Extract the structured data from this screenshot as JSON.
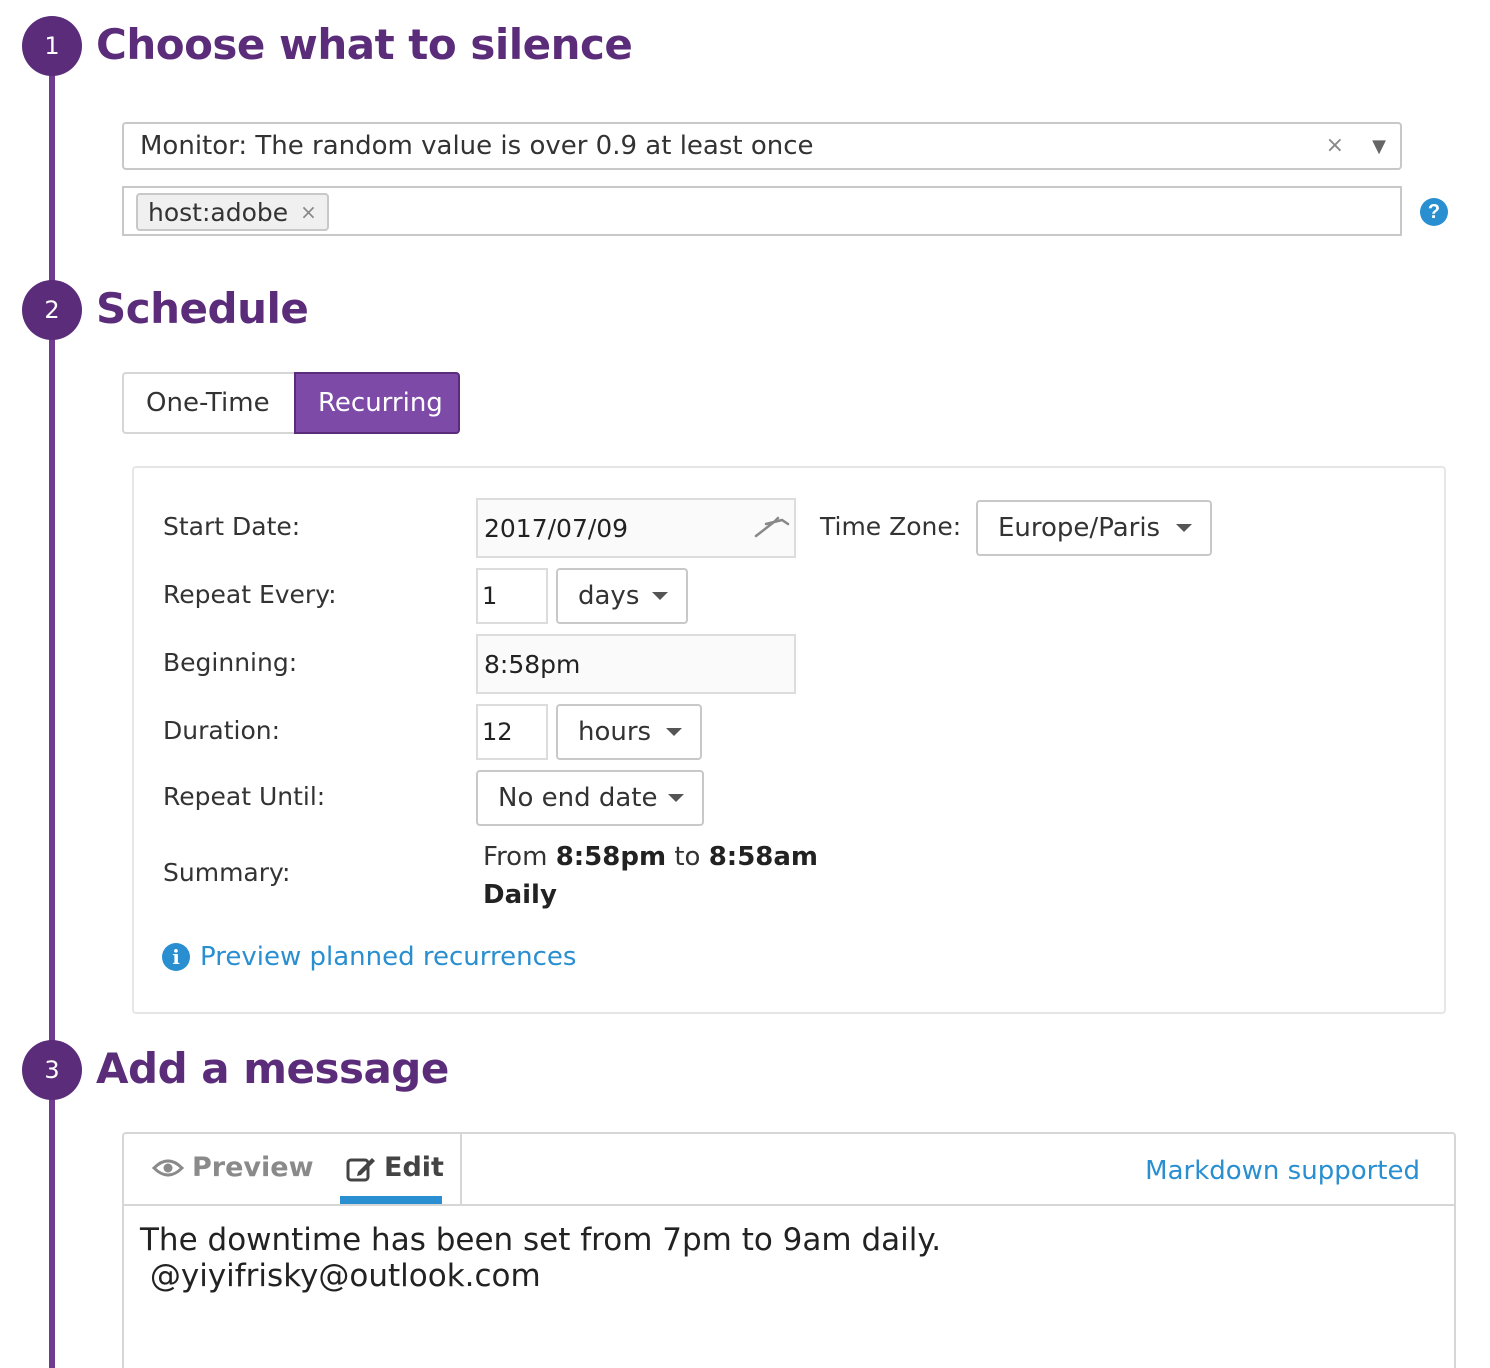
{
  "steps": [
    {
      "number": "1",
      "title": "Choose what to silence"
    },
    {
      "number": "2",
      "title": "Schedule"
    },
    {
      "number": "3",
      "title": "Add a message"
    }
  ],
  "silence": {
    "monitor_value": "Monitor: The random value is over 0.9 at least once",
    "clear_glyph": "×",
    "arrow_glyph": "▼",
    "tags": [
      {
        "label": "host:adobe",
        "remove_glyph": "×"
      }
    ],
    "help_glyph": "?"
  },
  "schedule": {
    "tabs": {
      "one_time": "One-Time",
      "recurring": "Recurring",
      "active": "recurring"
    },
    "labels": {
      "start_date": "Start Date:",
      "time_zone": "Time Zone:",
      "repeat_every": "Repeat Every:",
      "beginning": "Beginning:",
      "duration": "Duration:",
      "repeat_until": "Repeat Until:",
      "summary": "Summary:"
    },
    "values": {
      "start_date": "2017/07/09",
      "time_zone": "Europe/Paris",
      "repeat_every_count": "1",
      "repeat_every_unit": "days",
      "beginning": "8:58pm",
      "duration_count": "12",
      "duration_unit": "hours",
      "repeat_until": "No end date"
    },
    "summary": {
      "from_word": "From",
      "from_time": "8:58pm",
      "to_word": "to",
      "to_time": "8:58am",
      "frequency": "Daily"
    },
    "preview_link": "Preview planned recurrences",
    "info_glyph": "i"
  },
  "message": {
    "tabs": {
      "preview": "Preview",
      "edit": "Edit",
      "active": "edit"
    },
    "markdown_link": "Markdown supported",
    "text": "The downtime has been set from 7pm to 9am daily.\n @yiyifrisky@outlook.com"
  },
  "colors": {
    "brand_purple": "#5b2c7a",
    "active_button": "#7d4aa8",
    "link_blue": "#2a8fd0"
  }
}
